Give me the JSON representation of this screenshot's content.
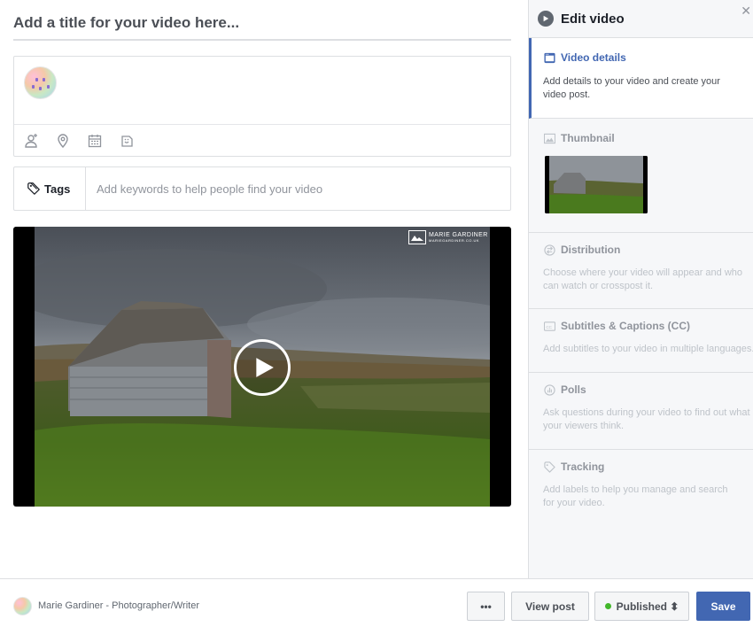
{
  "editor": {
    "title_placeholder": "Add a title for your video here...",
    "tags_label": "Tags",
    "tags_placeholder": "Add keywords to help people find your video"
  },
  "composer": {
    "tools": [
      "tag-people-icon",
      "location-icon",
      "calendar-icon",
      "sticker-icon"
    ]
  },
  "video": {
    "watermark_name": "MARIE GARDINER",
    "watermark_url": "MARIEGARDINER.CO.UK"
  },
  "panel": {
    "title": "Edit video",
    "sections": [
      {
        "title": "Video details",
        "desc": "Add details to your video and create your video post."
      },
      {
        "title": "Thumbnail",
        "desc": ""
      },
      {
        "title": "Distribution",
        "desc": "Choose where your video will appear and who can watch or crosspost it."
      },
      {
        "title": "Subtitles & Captions (CC)",
        "desc": "Add subtitles to your video in multiple languages."
      },
      {
        "title": "Polls",
        "desc": "Ask questions during your video to find out what your viewers think."
      },
      {
        "title": "Tracking",
        "desc": "Add labels to help you manage and search for your video."
      }
    ]
  },
  "footer": {
    "page_name": "Marie Gardiner - Photographer/Writer",
    "more_label": "•••",
    "view_post_label": "View post",
    "status_label": "Published ⬍",
    "save_label": "Save"
  },
  "colors": {
    "accent": "#4267b2",
    "status_green": "#42b72a"
  }
}
